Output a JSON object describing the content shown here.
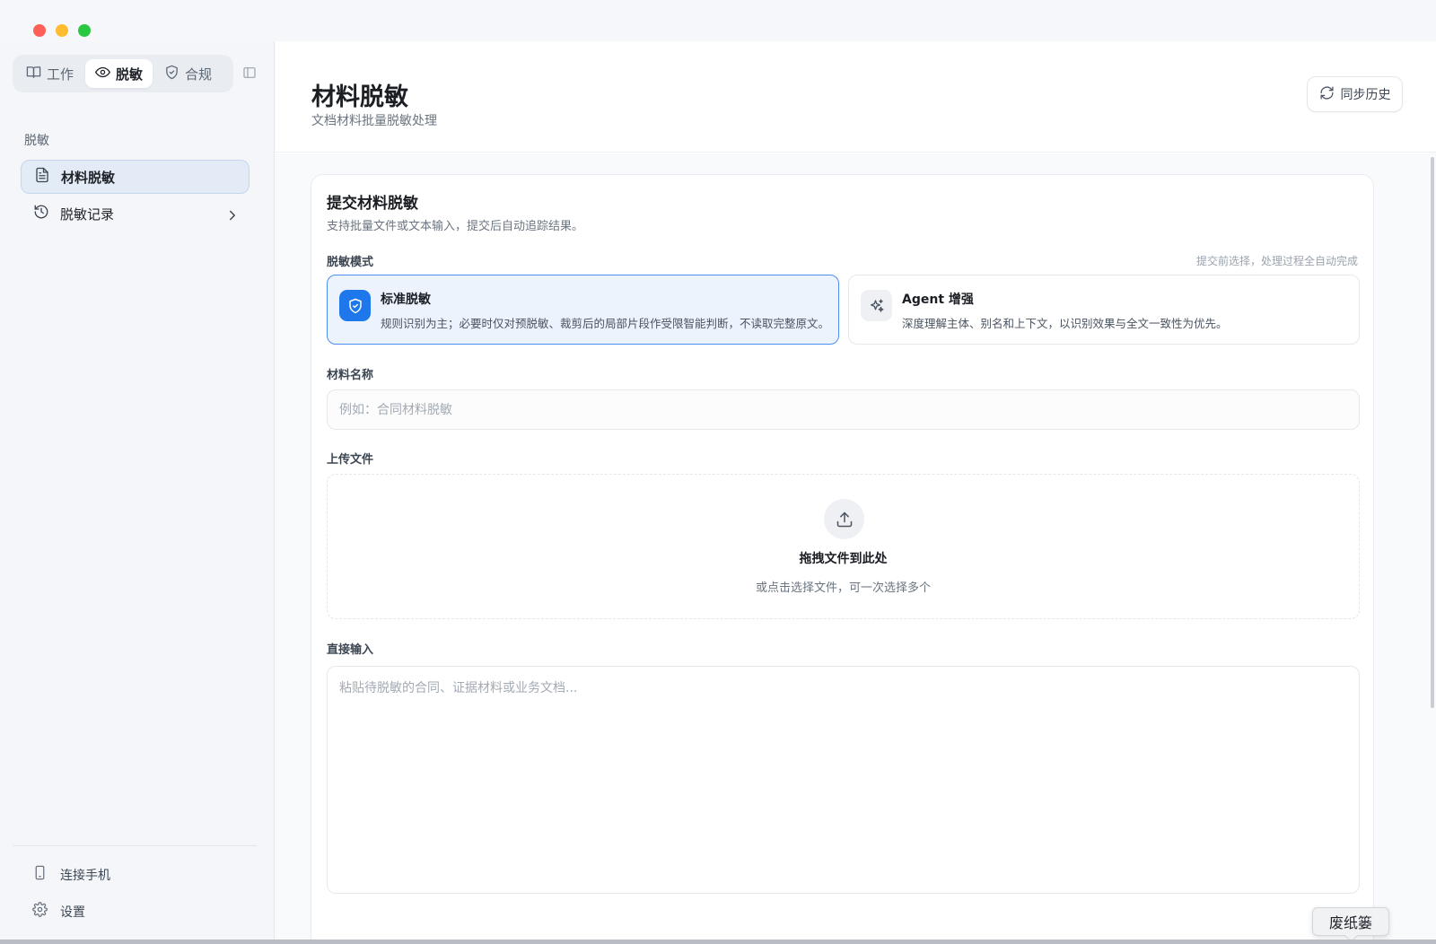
{
  "nav_tabs": [
    {
      "label": "工作",
      "icon": "book-icon"
    },
    {
      "label": "脱敏",
      "icon": "eye-icon",
      "active": true
    },
    {
      "label": "合规",
      "icon": "shield-icon"
    }
  ],
  "sidebar": {
    "section_label": "脱敏",
    "items": [
      {
        "label": "材料脱敏",
        "icon": "document-icon",
        "active": true
      },
      {
        "label": "脱敏记录",
        "icon": "history-icon"
      }
    ],
    "footer": [
      {
        "label": "连接手机",
        "icon": "phone-icon"
      },
      {
        "label": "设置",
        "icon": "gear-icon"
      }
    ]
  },
  "header": {
    "title": "材料脱敏",
    "subtitle": "文档材料批量脱敏处理",
    "sync_label": "同步历史"
  },
  "form": {
    "title": "提交材料脱敏",
    "description": "支持批量文件或文本输入，提交后自动追踪结果。",
    "mode_label": "脱敏模式",
    "mode_hint": "提交前选择，处理过程全自动完成",
    "modes": [
      {
        "name": "标准脱敏",
        "desc": "规则识别为主；必要时仅对预脱敏、裁剪后的局部片段作受限智能判断，不读取完整原文。",
        "selected": true
      },
      {
        "name": "Agent 增强",
        "desc": "深度理解主体、别名和上下文，以识别效果与全文一致性为优先。",
        "selected": false
      }
    ],
    "name_label": "材料名称",
    "name_value": "",
    "name_placeholder": "例如：合同材料脱敏",
    "upload_label": "上传文件",
    "upload_title": "拖拽文件到此处",
    "upload_sub": "或点击选择文件，可一次选择多个",
    "input_label": "直接输入",
    "input_value": "",
    "input_placeholder": "粘贴待脱敏的合同、证据材料或业务文档..."
  },
  "dock_tooltip": "废纸篓",
  "colors": {
    "accent": "#1e78ec",
    "active_bg": "#edf3fd",
    "active_border": "#4c8ef0"
  }
}
